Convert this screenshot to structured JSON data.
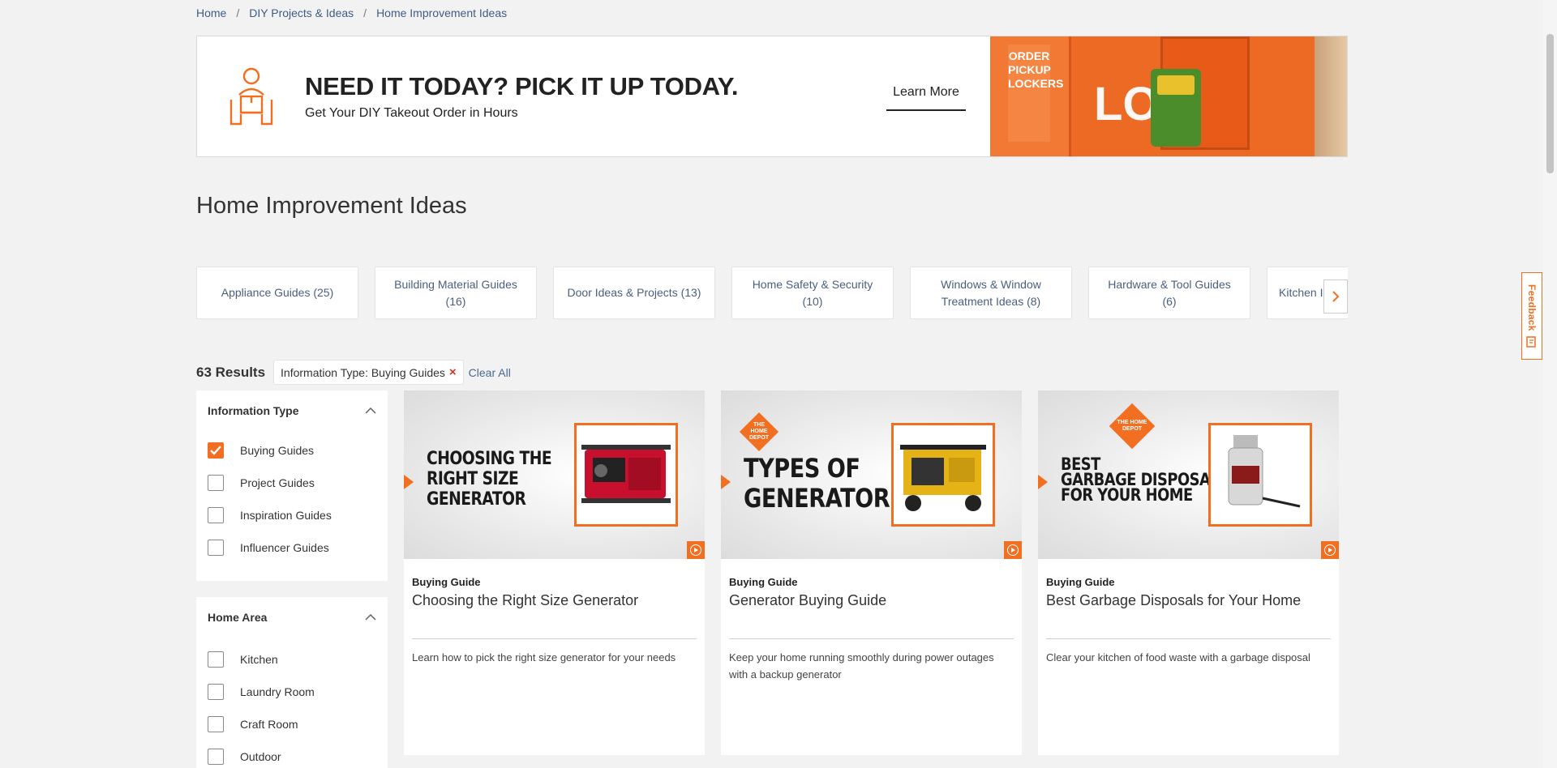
{
  "breadcrumb": {
    "items": [
      "Home",
      "DIY Projects & Ideas",
      "Home Improvement Ideas"
    ],
    "separator": "/"
  },
  "promo": {
    "title": "NEED IT TODAY? PICK IT UP TODAY.",
    "subtitle": "Get Your DIY Takeout Order in Hours",
    "cta": "Learn More",
    "image_sign": "ORDER PICKUP LOCKERS",
    "image_letters": "LO"
  },
  "page_title": "Home Improvement Ideas",
  "categories": [
    "Appliance Guides (25)",
    "Building Material Guides (16)",
    "Door Ideas & Projects (13)",
    "Home Safety & Security (10)",
    "Windows & Window Treatment Ideas (8)",
    "Hardware & Tool Guides (6)",
    "Kitchen Ic"
  ],
  "results": {
    "count": "63 Results",
    "chip": "Information Type: Buying Guides",
    "chip_remove": "×",
    "clear_all": "Clear All"
  },
  "filters": {
    "info_type": {
      "title": "Information Type",
      "items": [
        "Buying Guides",
        "Project Guides",
        "Inspiration Guides",
        "Influencer Guides"
      ],
      "checked": [
        true,
        false,
        false,
        false
      ]
    },
    "home_area": {
      "title": "Home Area",
      "items": [
        "Kitchen",
        "Laundry Room",
        "Craft Room",
        "Outdoor"
      ]
    }
  },
  "cards": [
    {
      "headline": "CHOOSING THE\nRIGHT SIZE\nGENERATOR",
      "type": "Buying Guide",
      "title": "Choosing the Right Size Generator",
      "desc": "Learn how to pick the right size generator for your needs"
    },
    {
      "headline": "TYPES OF\nGENERATORS",
      "type": "Buying Guide",
      "title": "Generator Buying Guide",
      "desc": "Keep your home running smoothly during power outages with a backup generator"
    },
    {
      "headline": "BEST\nGARBAGE DISPOSALS\nFOR YOUR HOME",
      "type": "Buying Guide",
      "title": "Best Garbage Disposals for Your Home",
      "desc": "Clear your kitchen of food waste with a garbage disposal"
    }
  ],
  "logo_text": "THE HOME DEPOT",
  "feedback": "Feedback",
  "colors": {
    "brand_orange": "#f26f21",
    "link_blue": "#4a6a93"
  }
}
